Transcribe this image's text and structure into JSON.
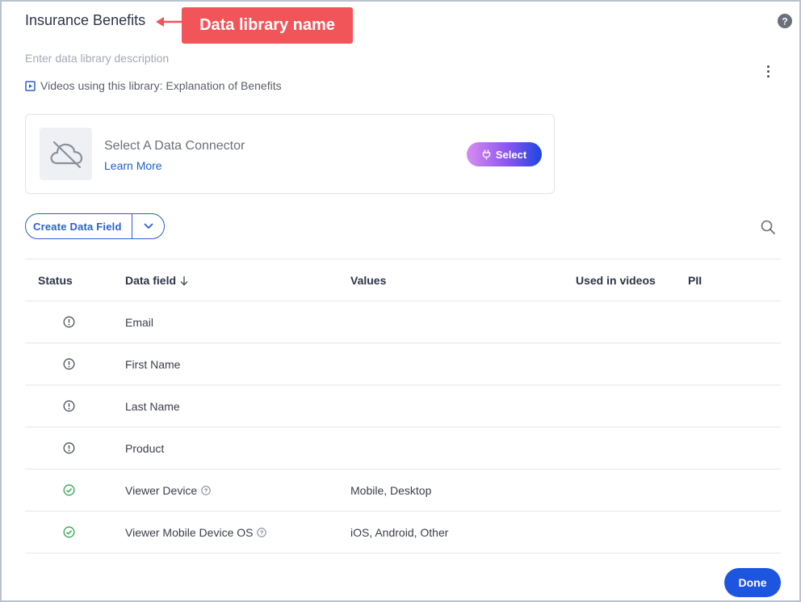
{
  "header": {
    "title": "Insurance Benefits",
    "callout": "Data library name",
    "description_placeholder": "Enter data library description",
    "videos_text": "Videos using this library: Explanation of Benefits"
  },
  "connector": {
    "title": "Select A Data Connector",
    "learn_more": "Learn More",
    "select_label": "Select"
  },
  "toolbar": {
    "create_label": "Create Data Field"
  },
  "table": {
    "columns": [
      "Status",
      "Data field",
      "Values",
      "Used in videos",
      "PII"
    ],
    "rows": [
      {
        "status": "warning",
        "field": "Email",
        "has_help": false,
        "values": "",
        "used": "",
        "pii": ""
      },
      {
        "status": "warning",
        "field": "First Name",
        "has_help": false,
        "values": "",
        "used": "",
        "pii": ""
      },
      {
        "status": "warning",
        "field": "Last Name",
        "has_help": false,
        "values": "",
        "used": "",
        "pii": ""
      },
      {
        "status": "warning",
        "field": "Product",
        "has_help": false,
        "values": "",
        "used": "",
        "pii": ""
      },
      {
        "status": "ok",
        "field": "Viewer Device",
        "has_help": true,
        "values": "Mobile, Desktop",
        "used": "",
        "pii": ""
      },
      {
        "status": "ok",
        "field": "Viewer Mobile Device OS",
        "has_help": true,
        "values": "iOS, Android, Other",
        "used": "",
        "pii": ""
      }
    ]
  },
  "footer": {
    "done_label": "Done"
  },
  "colors": {
    "accent": "#1d55e0",
    "callout": "#f1555a",
    "ok": "#2ea44f",
    "warning": "#4a4f5a"
  },
  "icons": {
    "help": "help-circle-icon",
    "more": "kebab-menu-icon",
    "video": "video-icon",
    "connector": "cloud-off-icon",
    "plug": "plug-icon",
    "search": "search-icon",
    "sort": "arrow-down-icon",
    "warning": "warning-circle-icon",
    "ok": "check-circle-icon"
  }
}
